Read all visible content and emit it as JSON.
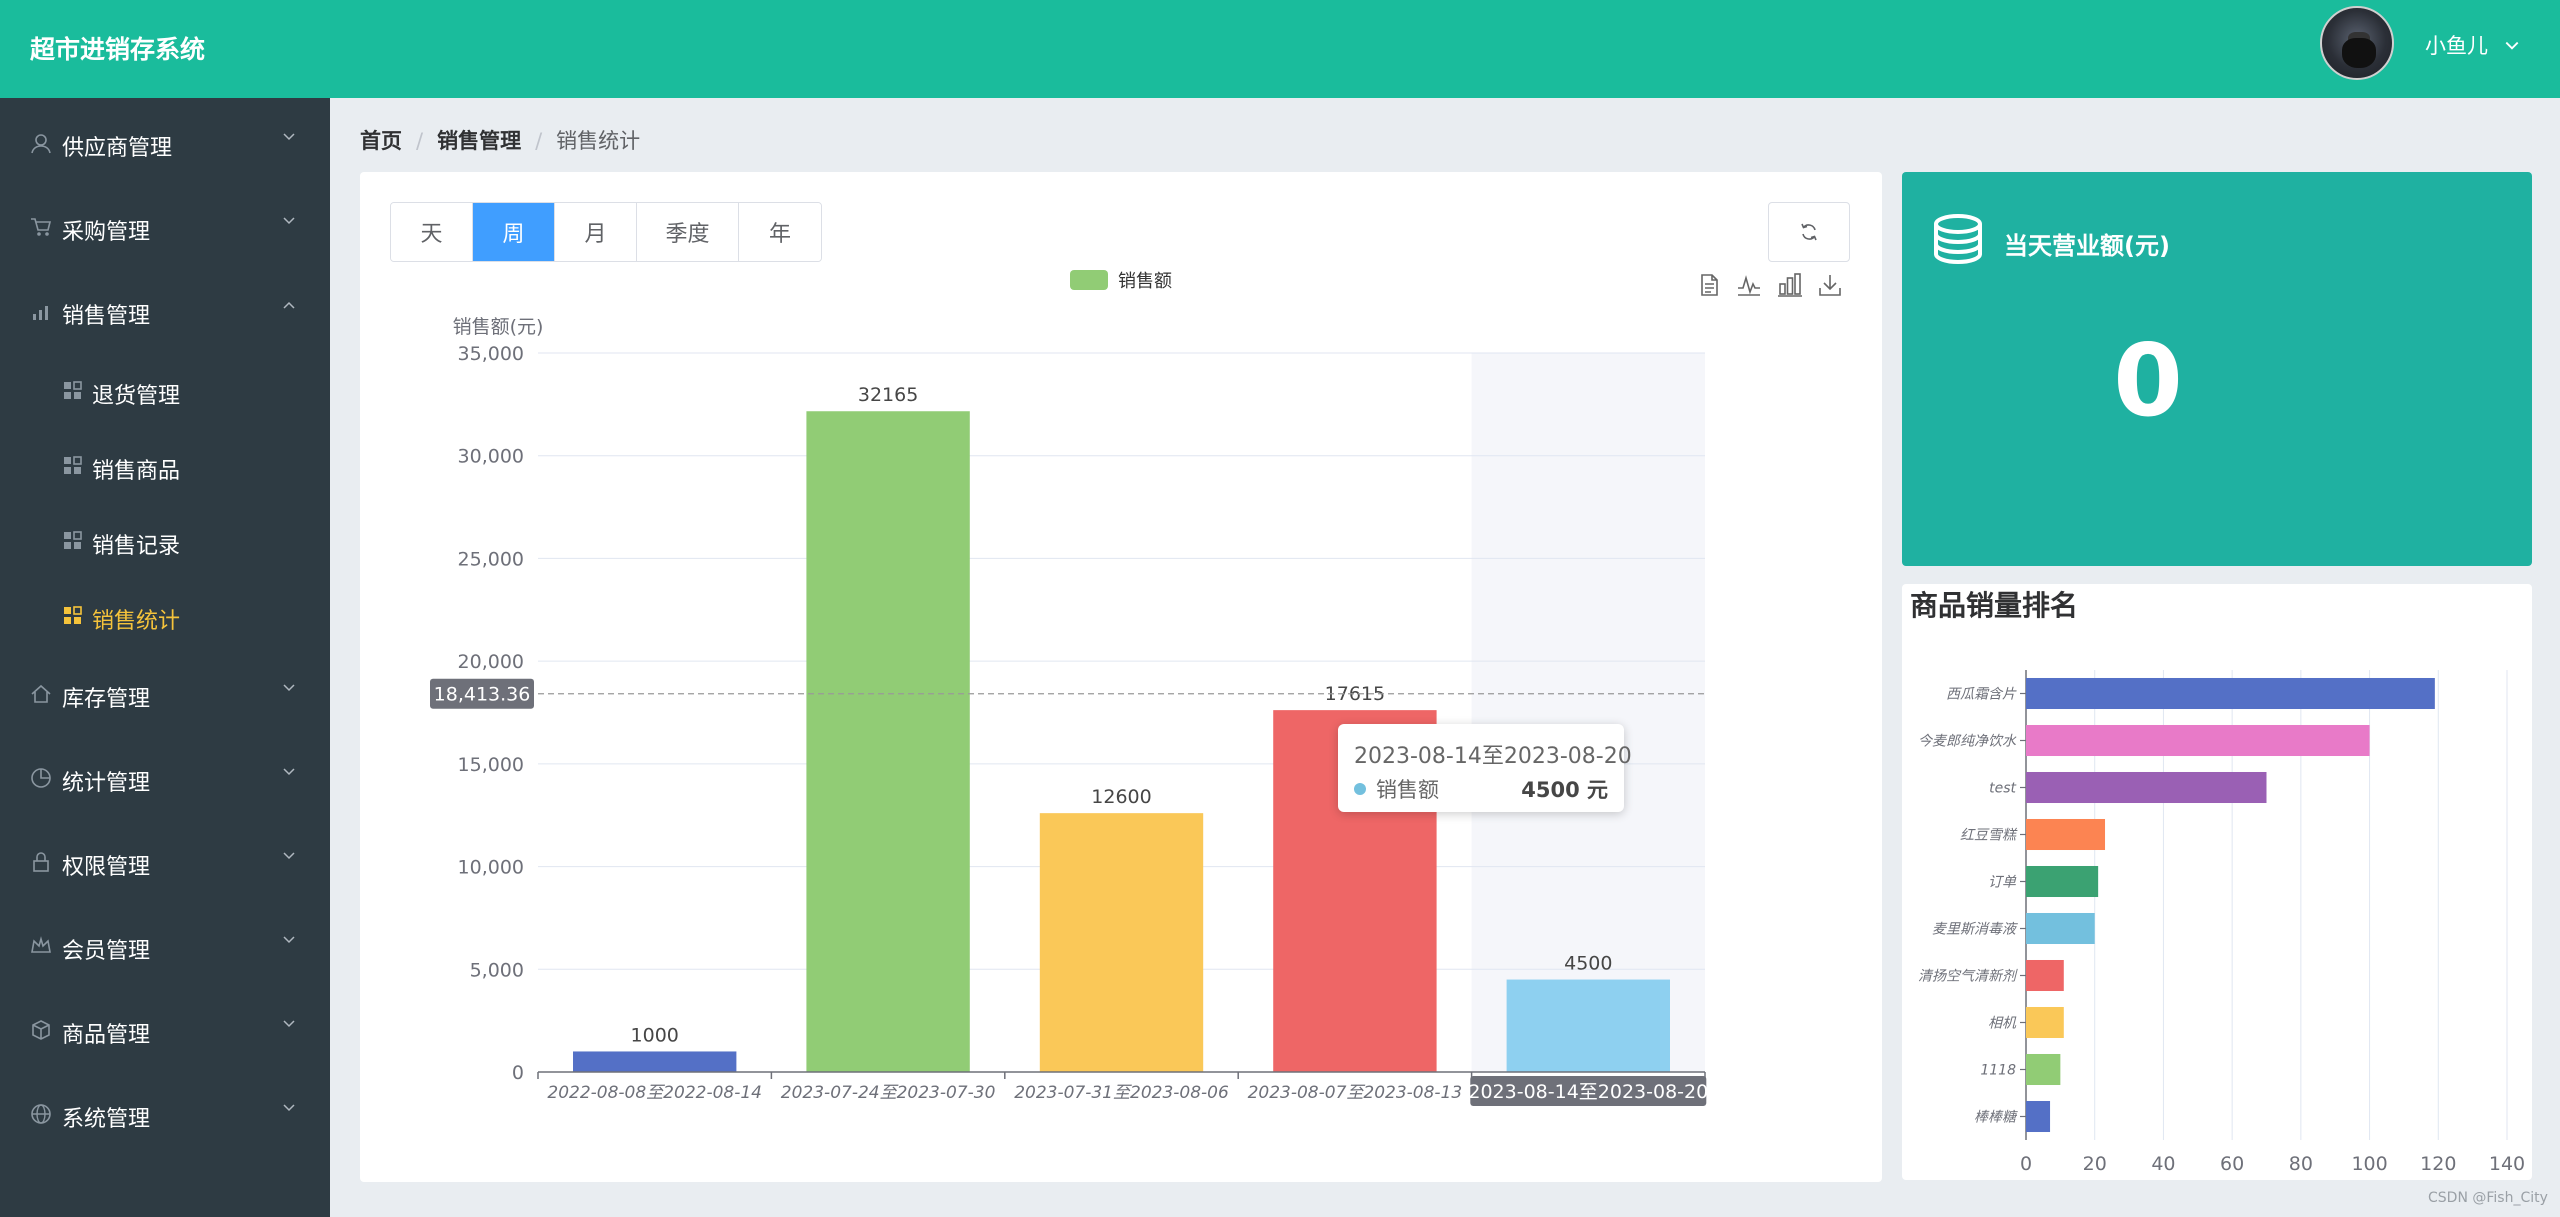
{
  "header": {
    "app_title": "超市进销存系统",
    "user_name": "小鱼儿",
    "user_caret": "∨"
  },
  "sidebar": {
    "items": [
      {
        "label": "供应商管理",
        "icon": "user-icon"
      },
      {
        "label": "采购管理",
        "icon": "cart-icon"
      },
      {
        "label": "销售管理",
        "icon": "signal-icon"
      },
      {
        "label": "退货管理",
        "icon": "grid-icon"
      },
      {
        "label": "销售商品",
        "icon": "grid-icon"
      },
      {
        "label": "销售记录",
        "icon": "grid-icon"
      },
      {
        "label": "销售统计",
        "icon": "grid-icon"
      },
      {
        "label": "库存管理",
        "icon": "home-icon"
      },
      {
        "label": "统计管理",
        "icon": "pie-icon"
      },
      {
        "label": "权限管理",
        "icon": "lock-icon"
      },
      {
        "label": "会员管理",
        "icon": "crown-icon"
      },
      {
        "label": "商品管理",
        "icon": "box-icon"
      },
      {
        "label": "系统管理",
        "icon": "globe-icon"
      }
    ],
    "active_color": "#f5c33b"
  },
  "breadcrumb": [
    "首页",
    "销售管理",
    "销售统计"
  ],
  "period_tabs": {
    "items": [
      "天",
      "周",
      "月",
      "季度",
      "年"
    ],
    "active": "周"
  },
  "toolbox": [
    "data-view-icon",
    "line-chart-icon",
    "bar-chart-icon",
    "download-icon"
  ],
  "chart_data": [
    {
      "type": "bar",
      "legend": [
        "销售额"
      ],
      "ylabel": "销售额(元)",
      "categories": [
        "2022-08-08至2022-08-14",
        "2023-07-24至2023-07-30",
        "2023-07-31至2023-08-06",
        "2023-08-07至2023-08-13",
        "2023-08-14至2023-08-20"
      ],
      "series": [
        {
          "name": "销售额",
          "values": [
            1000,
            32165,
            12600,
            17615,
            4500
          ]
        }
      ],
      "ylim": [
        0,
        35000
      ],
      "yticks": [
        "0",
        "5,000",
        "10,000",
        "15,000",
        "20,000",
        "25,000",
        "30,000",
        "35,000"
      ],
      "bar_colors": [
        "#5470c6",
        "#91cc75",
        "#fac858",
        "#ee6666",
        "#8ed0f0"
      ],
      "grid": true,
      "axis_pointer": {
        "value": 18413.36,
        "label": "18,413.36"
      },
      "highlighted_category": "2023-08-14至2023-08-20",
      "tooltip": {
        "title": "2023-08-14至2023-08-20",
        "series_name": "销售额",
        "value": "4500 元"
      }
    },
    {
      "type": "bar",
      "orientation": "horizontal",
      "title": "商品销量排名",
      "categories": [
        "西瓜霜含片",
        "今麦郎纯净饮水",
        "test",
        "红豆雪糕",
        "订单",
        "麦里斯消毒液",
        "清扬空气清新剂",
        "相机",
        "1118",
        "棒棒糖"
      ],
      "values": [
        119,
        100,
        70,
        23,
        21,
        20,
        11,
        11,
        10,
        7
      ],
      "xlim": [
        0,
        140
      ],
      "xticks": [
        "0",
        "20",
        "40",
        "60",
        "80",
        "100",
        "120",
        "140"
      ],
      "bar_colors": [
        "#5470c6",
        "#e87ac8",
        "#9a60b4",
        "#fc8452",
        "#3ba272",
        "#73c0de",
        "#ee6666",
        "#fac858",
        "#91cc75",
        "#5470c6"
      ],
      "grid": true
    }
  ],
  "revenue_card": {
    "title": "当天营业额(元)",
    "value": "0",
    "color": "#1fb1a1"
  },
  "watermark": "CSDN @Fish_City"
}
